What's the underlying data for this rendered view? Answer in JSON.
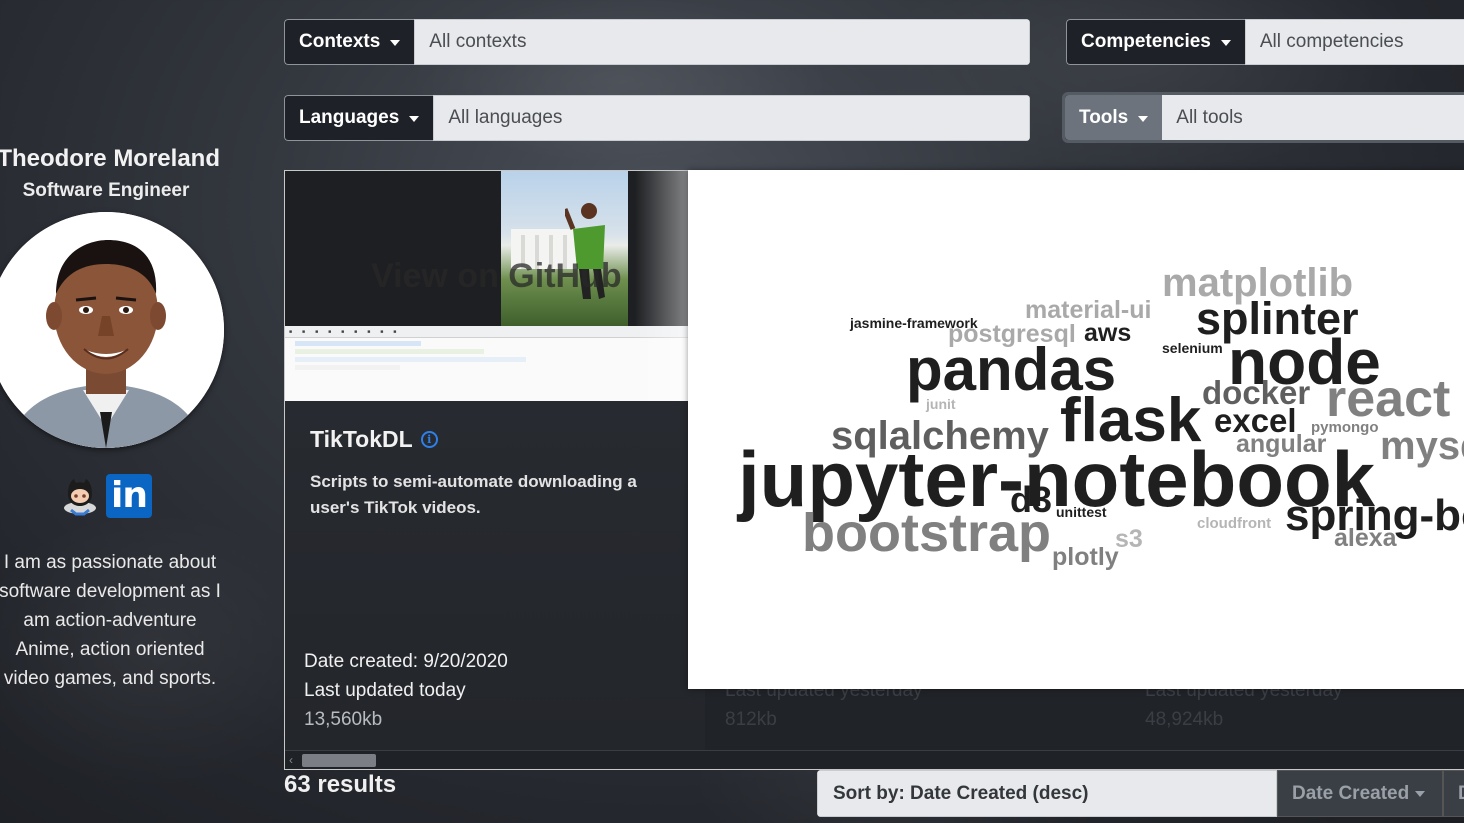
{
  "profile": {
    "name": "Theodore Moreland",
    "title": "Software Engineer",
    "bio": "I am as passionate about software development as I am action-adventure Anime, action oriented video games, and sports.",
    "social": {
      "github_icon": "github-octocat-icon",
      "linkedin_label": "in"
    }
  },
  "filters": {
    "contexts": {
      "label": "Contexts",
      "value": "All contexts"
    },
    "competencies": {
      "label": "Competencies",
      "value": "All competencies"
    },
    "languages": {
      "label": "Languages",
      "value": "All languages"
    },
    "tools": {
      "label": "Tools",
      "value": "All tools"
    }
  },
  "cards": [
    {
      "overlay_text": "View on GitHub",
      "title": "TikTokDL",
      "description": "Scripts to semi-automate downloading a user's TikTok videos.",
      "date_created": "Date created: 9/20/2020",
      "last_updated": "Last updated today",
      "size": "13,560kb"
    },
    {
      "last_updated": "Last updated yesterday",
      "size": "812kb"
    },
    {
      "last_updated": "Last updated yesterday",
      "size": "48,924kb"
    }
  ],
  "word_cloud": {
    "words": [
      {
        "text": "matplotlib",
        "color": "#a9a9a9"
      },
      {
        "text": "material-ui",
        "color": "#a9a9a9"
      },
      {
        "text": "jasmine-framework",
        "color": "#1f1f1f"
      },
      {
        "text": "postgresql",
        "color": "#a9a9a9"
      },
      {
        "text": "aws",
        "color": "#1f1f1f"
      },
      {
        "text": "splinter",
        "color": "#1f1f1f"
      },
      {
        "text": "selenium",
        "color": "#1f1f1f"
      },
      {
        "text": "node",
        "color": "#1f1f1f"
      },
      {
        "text": "pandas",
        "color": "#1f1f1f"
      },
      {
        "text": "docker",
        "color": "#5f5f5f"
      },
      {
        "text": "react",
        "color": "#808080"
      },
      {
        "text": "junit",
        "color": "#b5b5b5"
      },
      {
        "text": "flask",
        "color": "#1f1f1f"
      },
      {
        "text": "excel",
        "color": "#1f1f1f"
      },
      {
        "text": "sqlalchemy",
        "color": "#5f5f5f"
      },
      {
        "text": "angular",
        "color": "#808080"
      },
      {
        "text": "pymongo",
        "color": "#808080"
      },
      {
        "text": "mysql",
        "color": "#808080"
      },
      {
        "text": "jupyter-notebook",
        "color": "#1f1f1f"
      },
      {
        "text": "d3",
        "color": "#1f1f1f"
      },
      {
        "text": "unittest",
        "color": "#1f1f1f"
      },
      {
        "text": "bootstrap",
        "color": "#808080"
      },
      {
        "text": "s3",
        "color": "#b5b5b5"
      },
      {
        "text": "cloudfront",
        "color": "#b5b5b5"
      },
      {
        "text": "spring-boot",
        "color": "#1f1f1f"
      },
      {
        "text": "alexa",
        "color": "#808080"
      },
      {
        "text": "plotly",
        "color": "#808080"
      }
    ]
  },
  "results": {
    "count": "63 results",
    "sort_label": "Sort by: Date Created (desc)",
    "sort_field": "Date Created",
    "sort_direction": "D"
  }
}
